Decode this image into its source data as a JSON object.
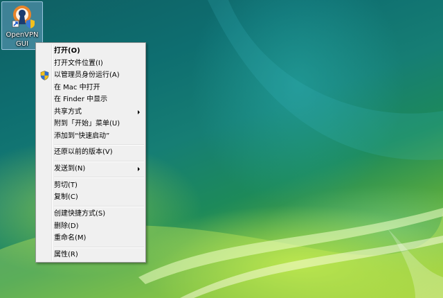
{
  "desktop": {
    "icon": {
      "name": "openvpn-gui",
      "label_line1": "OpenVPN",
      "label_line2": "GUI"
    }
  },
  "context_menu": {
    "items": [
      {
        "label": "打开(O)",
        "bold": true
      },
      {
        "label": "打开文件位置(I)"
      },
      {
        "label": "以管理员身份运行(A)",
        "icon": "uac-shield-icon"
      },
      {
        "label": "在 Mac 中打开"
      },
      {
        "label": "在 Finder 中显示"
      },
      {
        "label": "共享方式",
        "submenu": true
      },
      {
        "label": "附到「开始」菜单(U)"
      },
      {
        "label": "添加到“快速启动”"
      },
      {
        "label": "还原以前的版本(V)"
      },
      {
        "label": "发送到(N)",
        "submenu": true
      },
      {
        "label": "剪切(T)"
      },
      {
        "label": "复制(C)"
      },
      {
        "label": "创建快捷方式(S)"
      },
      {
        "label": "删除(D)"
      },
      {
        "label": "重命名(M)"
      },
      {
        "label": "属性(R)"
      }
    ]
  },
  "colors": {
    "menu_background": "#f0f0f0",
    "menu_border": "#979797",
    "icon_selection": "#7aaad2"
  }
}
